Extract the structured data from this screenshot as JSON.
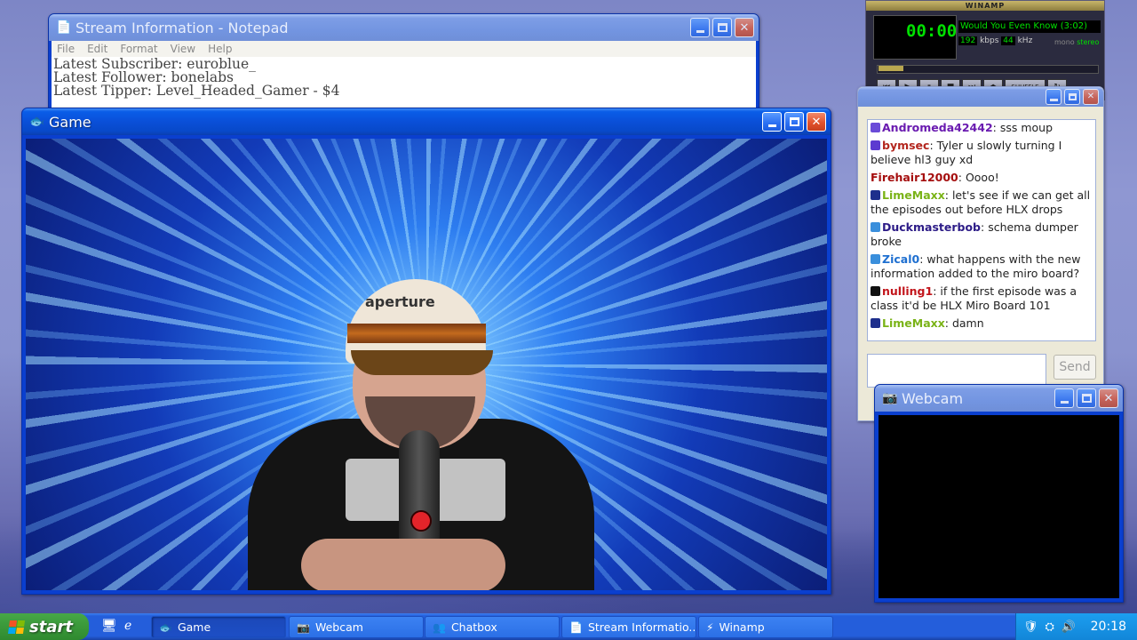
{
  "notepad": {
    "title": "Stream Information - Notepad",
    "menu": [
      "File",
      "Edit",
      "Format",
      "View",
      "Help"
    ],
    "lines": [
      "Latest Subscriber: euroblue_",
      "Latest Follower: bonelabs",
      "Latest Tipper: Level_Headed_Gamer - $4"
    ]
  },
  "game": {
    "title": "Game",
    "cap_logo": "aperture"
  },
  "chatbox": {
    "messages": [
      {
        "user": "Andromeda42442",
        "color": "#6a1bb0",
        "text": "sss moup"
      },
      {
        "user": "bymsec",
        "color": "#b3261e",
        "text": "Tyler u slowly turning I believe hl3 guy xd"
      },
      {
        "user": "Firehair12000",
        "color": "#a50e0e",
        "text": "Oooo!"
      },
      {
        "user": "LimeMaxx",
        "color": "#7ab317",
        "text": "let's see if we can get all the episodes out before HLX drops"
      },
      {
        "user": "Duckmasterbob",
        "color": "#2c1b87",
        "text": "schema dumper broke"
      },
      {
        "user": "Zical0",
        "color": "#1e6fd0",
        "text": "what happens with the new information added to the miro board?"
      },
      {
        "user": "nulling1",
        "color": "#c2151b",
        "text": "if the first episode was a class it'd be HLX Miro Board 101"
      },
      {
        "user": "LimeMaxx",
        "color": "#7ab317",
        "text": "damn"
      }
    ],
    "send_label": "Send"
  },
  "webcam": {
    "title": "Webcam"
  },
  "winamp": {
    "title": "WINAMP",
    "time": "00:00",
    "song": "Would You Even Know (3:02)",
    "kbps": "192",
    "kbps_label": "kbps",
    "khz": "44",
    "khz_label": "kHz",
    "mono": "mono",
    "stereo": "stereo",
    "shuffle": "SHUFFLE"
  },
  "taskbar": {
    "start": "start",
    "tasks": [
      {
        "label": "Game",
        "icon": "game-icon",
        "glyph": "🐟"
      },
      {
        "label": "Webcam",
        "icon": "camera-icon",
        "glyph": "📷"
      },
      {
        "label": "Chatbox",
        "icon": "users-icon",
        "glyph": "👥"
      },
      {
        "label": "Stream Informatio...",
        "icon": "notepad-icon",
        "glyph": "📄"
      },
      {
        "label": "Winamp",
        "icon": "winamp-icon",
        "glyph": "⚡"
      }
    ],
    "clock": "20:18"
  },
  "colors": {
    "xp_blue": "#0a4fd8",
    "taskbar": "#245edb",
    "start_green": "#3c9b3c",
    "tray": "#1286d8"
  }
}
